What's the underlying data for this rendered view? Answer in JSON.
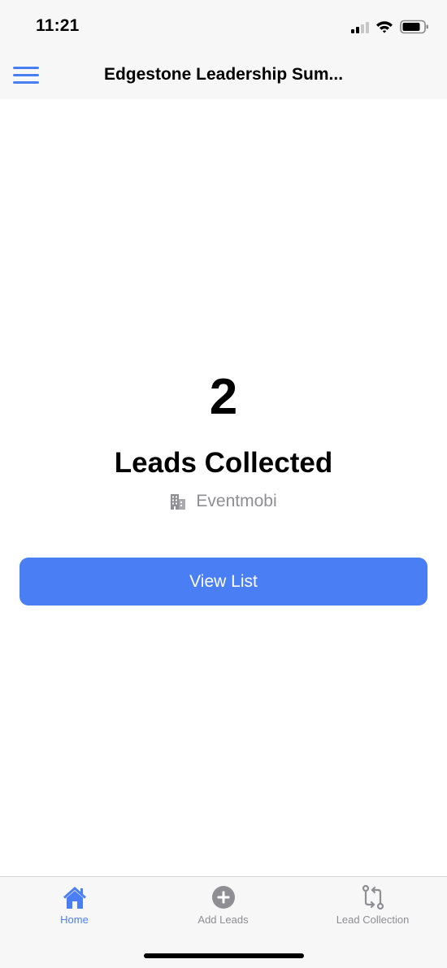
{
  "status_bar": {
    "time": "11:21",
    "icons": [
      "cellular-signal-icon",
      "wifi-icon",
      "battery-icon"
    ]
  },
  "header": {
    "title": "Edgestone Leadership Sum...",
    "menu_icon": "hamburger-menu-icon"
  },
  "summary": {
    "count": "2",
    "label": "Leads Collected",
    "organization": "Eventmobi",
    "organization_icon": "building-icon"
  },
  "actions": {
    "view_list": "View List"
  },
  "tabs": [
    {
      "label": "Home",
      "icon": "home-icon",
      "active": true
    },
    {
      "label": "Add Leads",
      "icon": "plus-circle-icon",
      "active": false
    },
    {
      "label": "Lead Collection",
      "icon": "sync-compare-icon",
      "active": false
    }
  ],
  "colors": {
    "accent": "#4a7ef5",
    "muted": "#8e8e93",
    "bar_background": "#f7f7f7"
  }
}
